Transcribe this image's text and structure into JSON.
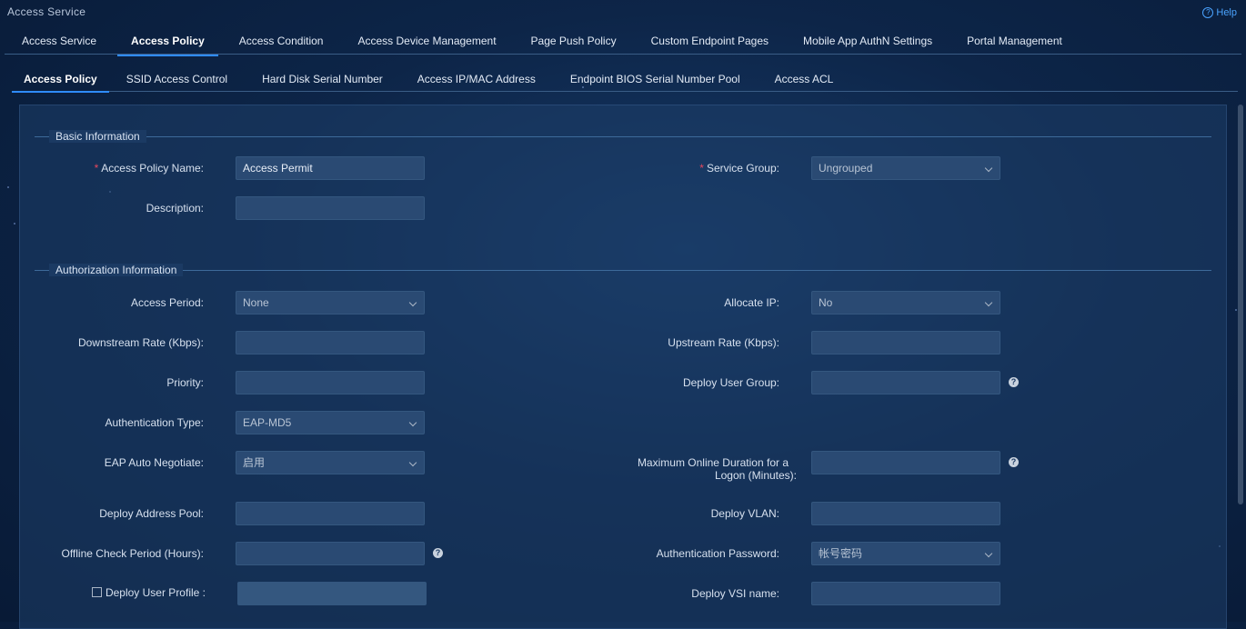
{
  "app_title": "Access Service",
  "help_label": "Help",
  "top_tabs": [
    "Access Service",
    "Access Policy",
    "Access Condition",
    "Access Device Management",
    "Page Push Policy",
    "Custom Endpoint Pages",
    "Mobile App AuthN Settings",
    "Portal Management"
  ],
  "sub_tabs": [
    "Access Policy",
    "SSID Access Control",
    "Hard Disk Serial Number",
    "Access IP/MAC Address",
    "Endpoint BIOS Serial Number Pool",
    "Access ACL"
  ],
  "sections": {
    "basic": "Basic Information",
    "auth": "Authorization Information"
  },
  "required_mark": "*",
  "form": {
    "policy_name": {
      "label": "Access Policy Name:",
      "value": "Access Permit"
    },
    "service_group": {
      "label": "Service Group:",
      "value": "Ungrouped"
    },
    "description": {
      "label": "Description:",
      "value": ""
    },
    "access_period": {
      "label": "Access Period:",
      "value": "None"
    },
    "allocate_ip": {
      "label": "Allocate IP:",
      "value": "No"
    },
    "downstream_rate": {
      "label": "Downstream Rate (Kbps):",
      "value": ""
    },
    "upstream_rate": {
      "label": "Upstream Rate (Kbps):",
      "value": ""
    },
    "priority": {
      "label": "Priority:",
      "value": ""
    },
    "deploy_user_group": {
      "label": "Deploy User Group:",
      "value": ""
    },
    "auth_type": {
      "label": "Authentication Type:",
      "value": "EAP-MD5"
    },
    "eap_auto": {
      "label": "EAP Auto Negotiate:",
      "value": "启用"
    },
    "max_online_1": "Maximum Online Duration for a",
    "max_online_2": "Logon (Minutes):",
    "max_online_value": "",
    "deploy_address_pool": {
      "label": "Deploy Address Pool:",
      "value": ""
    },
    "deploy_vlan": {
      "label": "Deploy VLAN:",
      "value": ""
    },
    "offline_check": {
      "label": "Offline Check Period (Hours):",
      "value": ""
    },
    "auth_password": {
      "label": "Authentication Password:",
      "value": "帐号密码"
    },
    "deploy_user_profile": {
      "label": "Deploy User Profile :",
      "value": ""
    },
    "deploy_vsi": {
      "label": "Deploy VSI name:",
      "value": ""
    }
  },
  "colors": {
    "accent": "#2f8cff",
    "required": "#e6475d",
    "panel": "#1e3e68"
  }
}
